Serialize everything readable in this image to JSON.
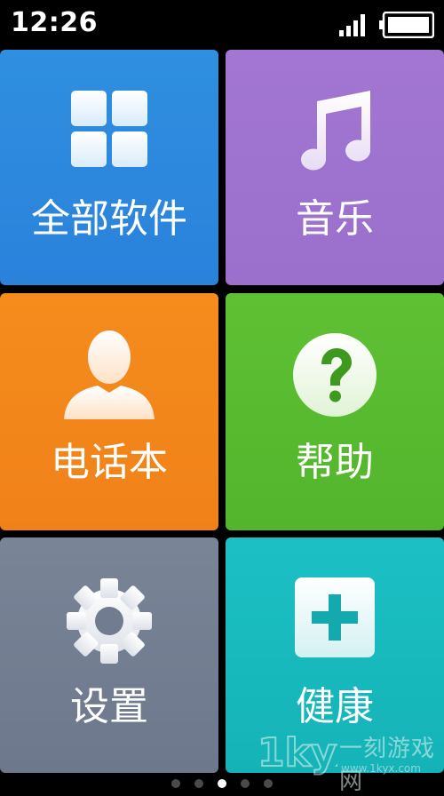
{
  "status_bar": {
    "time": "12:26"
  },
  "tiles": {
    "all_apps": {
      "label": "全部软件",
      "icon": "grid-icon",
      "color": "#2a86dc"
    },
    "music": {
      "label": "音乐",
      "icon": "music-note-icon",
      "color": "#9e73cf"
    },
    "contacts": {
      "label": "电话本",
      "icon": "person-icon",
      "color": "#f2851a"
    },
    "help": {
      "label": "帮助",
      "icon": "question-icon",
      "color": "#58ba2f"
    },
    "settings": {
      "label": "设置",
      "icon": "gear-icon",
      "color": "#747e91"
    },
    "health": {
      "label": "健康",
      "icon": "plus-box-icon",
      "color": "#18b9bd"
    }
  },
  "pager": {
    "active_page": 3,
    "page_count": 5
  },
  "watermark": {
    "logo_text": "1kyx",
    "text": "一刻游戏网",
    "url": "www.1kyx.com"
  }
}
